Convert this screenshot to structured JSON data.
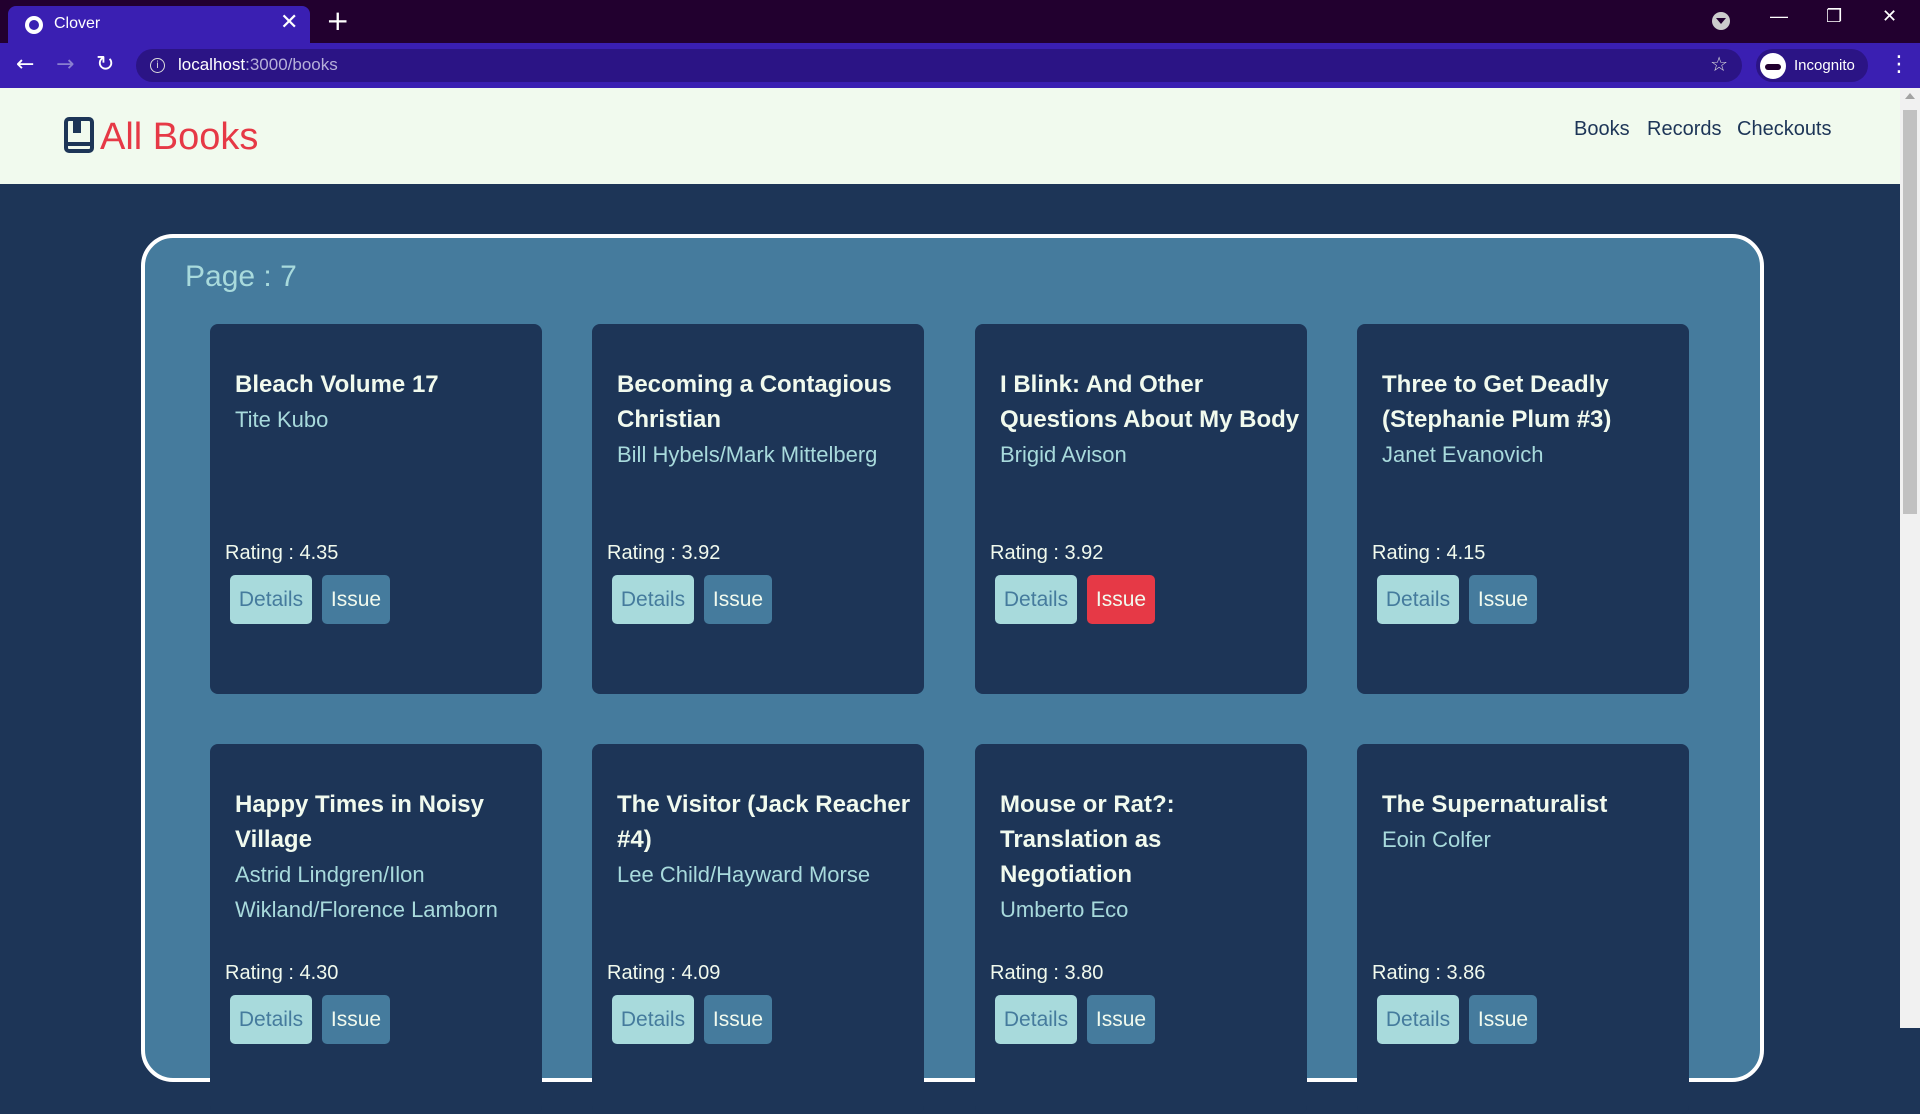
{
  "browser": {
    "tab_title": "Clover",
    "tab_close": "✕",
    "new_tab": "+",
    "url_host": "localhost",
    "url_path": ":3000/books",
    "profile_label": "Incognito",
    "minimize": "—",
    "restore": "❐",
    "close": "✕"
  },
  "header": {
    "brand": "All Books",
    "nav": {
      "books": "Books",
      "records": "Records",
      "checkouts": "Checkouts"
    }
  },
  "page_label": "Page : 7",
  "books": [
    {
      "title": "Bleach Volume 17",
      "author": "Tite Kubo",
      "rating": "Rating : 4.35",
      "details": "Details",
      "issue": "Issue"
    },
    {
      "title": "Becoming a Contagious Christian",
      "author": "Bill Hybels/Mark Mittelberg",
      "rating": "Rating : 3.92",
      "details": "Details",
      "issue": "Issue"
    },
    {
      "title": "I Blink: And Other Questions About My Body",
      "author": "Brigid Avison",
      "rating": "Rating : 3.92",
      "details": "Details",
      "issue": "Issue"
    },
    {
      "title": "Three to Get Deadly (Stephanie Plum #3)",
      "author": "Janet Evanovich",
      "rating": "Rating : 4.15",
      "details": "Details",
      "issue": "Issue"
    },
    {
      "title": "Happy Times in Noisy Village",
      "author": "Astrid Lindgren/Ilon Wikland/Florence Lamborn",
      "rating": "Rating : 4.30",
      "details": "Details",
      "issue": "Issue"
    },
    {
      "title": "The Visitor (Jack Reacher #4)",
      "author": "Lee Child/Hayward Morse",
      "rating": "Rating : 4.09",
      "details": "Details",
      "issue": "Issue"
    },
    {
      "title": "Mouse or Rat?: Translation as Negotiation",
      "author": "Umberto Eco",
      "rating": "Rating : 3.80",
      "details": "Details",
      "issue": "Issue"
    },
    {
      "title": "The Supernaturalist",
      "author": "Eoin Colfer",
      "rating": "Rating : 3.86",
      "details": "Details",
      "issue": "Issue"
    }
  ],
  "colors": {
    "brand": "#e63946",
    "page_bg": "#1d3557",
    "panel": "#457b9d",
    "accent_light": "#a8dadc",
    "header_bg": "#f1faee"
  }
}
